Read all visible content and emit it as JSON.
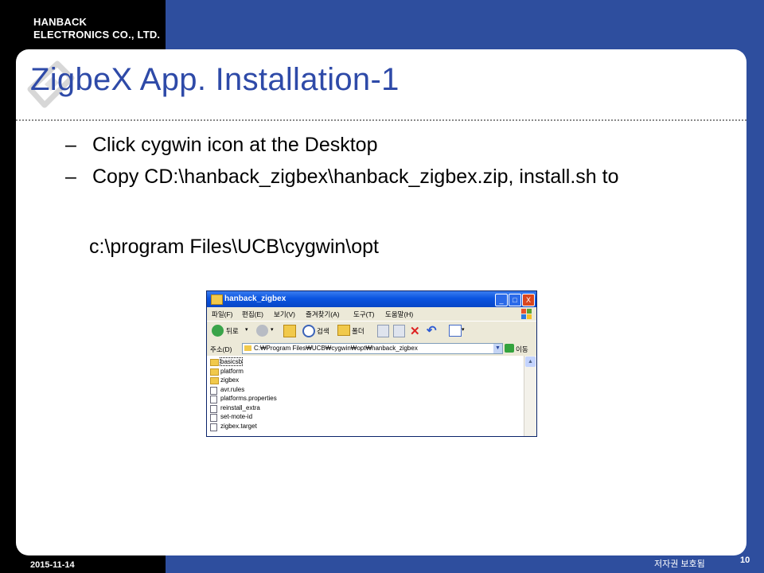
{
  "company": {
    "line1": "HANBACK",
    "line2": "ELECTRONICS CO., LTD."
  },
  "slide": {
    "title": "ZigbeX App. Installation-1",
    "bullets": [
      {
        "dash": "–",
        "text": "Click  cygwin icon at the Desktop"
      },
      {
        "dash": "–",
        "text": "Copy CD:\\hanback_zigbex\\hanback_zigbex.zip, install.sh to"
      }
    ],
    "subpath": "c:\\program Files\\UCB\\cygwin\\opt"
  },
  "footer": {
    "date": "2015-11-14",
    "copyright": "저자권 보호됨",
    "page": "10"
  },
  "explorer": {
    "title": "hanback_zigbex",
    "window_buttons": {
      "minimize": "_",
      "maximize": "□",
      "close": "X"
    },
    "menu": [
      "파일(F)",
      "편집(E)",
      "보기(V)",
      "즐겨찾기(A)",
      "도구(T)",
      "도움말(H)"
    ],
    "toolbar": {
      "back_label": "뒤로",
      "search_label": "검색",
      "folders_label": "폴더"
    },
    "address": {
      "label": "주소(D)",
      "value": "C:₩Program Files₩UCB₩cygwin₩opt₩hanback_zigbex",
      "go_label": "이동"
    },
    "files": [
      {
        "name": "basicsb",
        "type": "folder",
        "selected": true
      },
      {
        "name": "platform",
        "type": "folder"
      },
      {
        "name": "zigbex",
        "type": "folder"
      },
      {
        "name": "avr.rules",
        "type": "file"
      },
      {
        "name": "platforms.properties",
        "type": "file"
      },
      {
        "name": "reinstall_extra",
        "type": "file"
      },
      {
        "name": "set-mote-id",
        "type": "file"
      },
      {
        "name": "zigbex.target",
        "type": "file"
      }
    ]
  },
  "colors": {
    "band": "#2e4e9e",
    "title": "#2e4aa8",
    "xp_title": "#0a54e0"
  }
}
